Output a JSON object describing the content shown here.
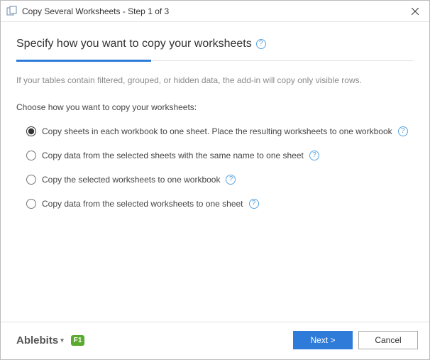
{
  "titlebar": {
    "title": "Copy Several Worksheets - Step 1 of 3"
  },
  "heading": "Specify how you want to copy your worksheets",
  "info_text": "If your tables contain filtered, grouped, or hidden data, the add-in will copy only visible rows.",
  "choose_label": "Choose how you want to copy your worksheets:",
  "options": [
    {
      "label": "Copy sheets in each workbook to one sheet. Place the resulting worksheets to one workbook",
      "selected": true
    },
    {
      "label": "Copy data from the selected sheets with the same name to one sheet",
      "selected": false
    },
    {
      "label": "Copy the selected worksheets to one workbook",
      "selected": false
    },
    {
      "label": "Copy data from the selected worksheets to one sheet",
      "selected": false
    }
  ],
  "footer": {
    "brand": "Ablebits",
    "f1": "F1",
    "next": "Next >",
    "cancel": "Cancel"
  }
}
